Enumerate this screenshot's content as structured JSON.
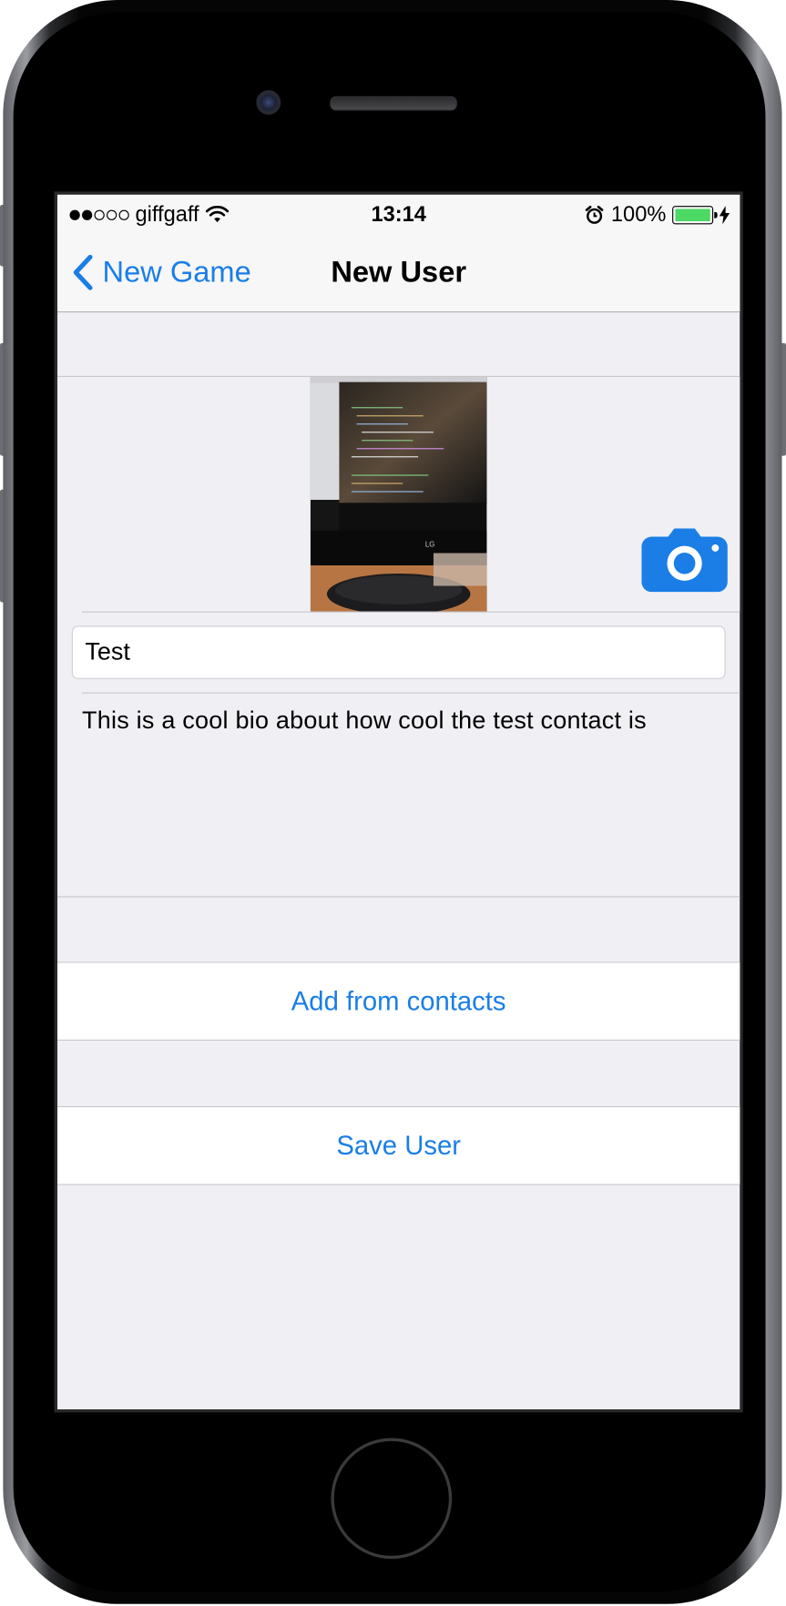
{
  "status_bar": {
    "carrier": "giffgaff",
    "signal_bars_filled": 2,
    "signal_bars_total": 5,
    "time": "13:14",
    "battery_percent": "100%",
    "battery_level": 1.0,
    "battery_color": "#4cd964",
    "icons": [
      "wifi-icon",
      "alarm-icon",
      "charging-bolt-icon"
    ]
  },
  "nav_bar": {
    "back_label": "New Game",
    "title": "New User"
  },
  "profile": {
    "photo_icon": "user-photo",
    "camera_icon": "camera-icon"
  },
  "form": {
    "name_value": "Test",
    "bio_text": "This is a cool bio about how cool the test contact is"
  },
  "actions": {
    "add_from_contacts_label": "Add from contacts",
    "save_user_label": "Save User"
  },
  "colors": {
    "accent": "#1a7ee6",
    "background": "#efeff4"
  }
}
